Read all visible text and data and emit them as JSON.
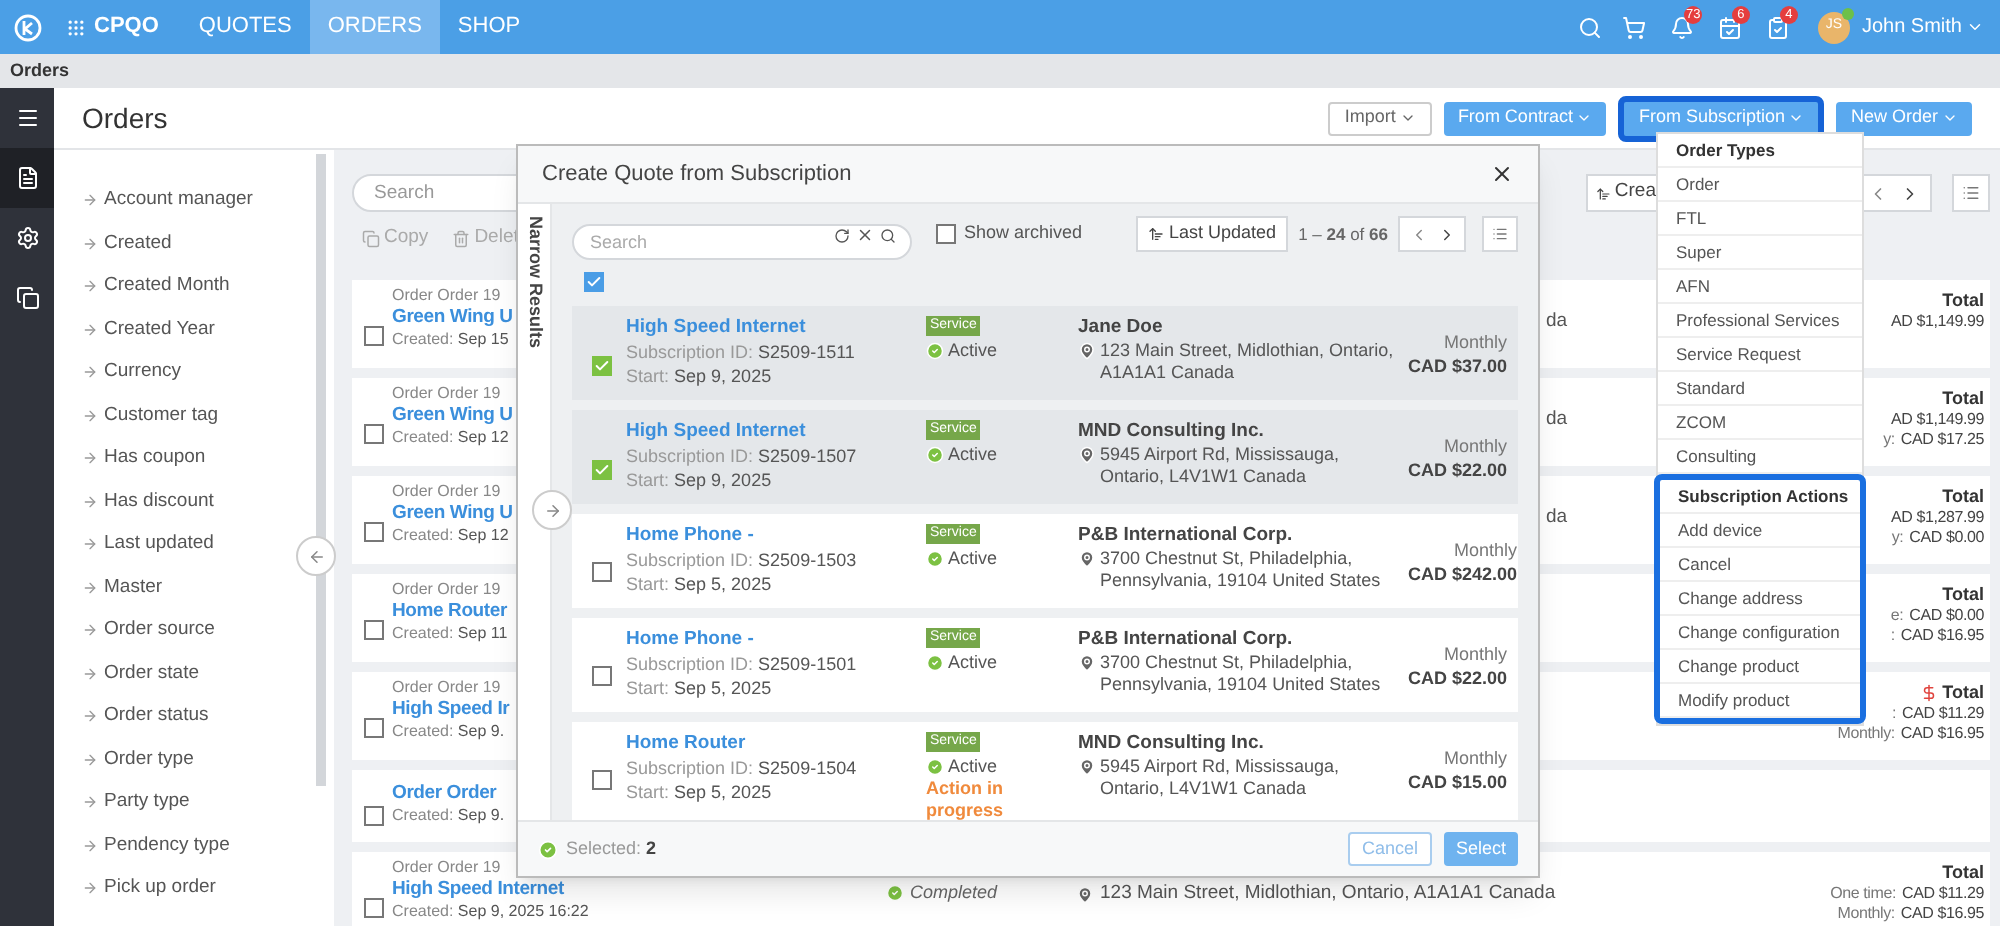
{
  "top_bar": {
    "brand": "CPQO",
    "nav": [
      {
        "label": "QUOTES",
        "selected": false
      },
      {
        "label": "ORDERS",
        "selected": true
      },
      {
        "label": "SHOP",
        "selected": false
      }
    ],
    "alerts": [
      {
        "kind": "bell",
        "count": "73"
      },
      {
        "kind": "calendar",
        "count": "6"
      },
      {
        "kind": "tasks",
        "count": "4"
      }
    ],
    "user": {
      "initials": "JS",
      "name": "John Smith"
    }
  },
  "breadcrumb": "Orders",
  "side_nav": [
    {
      "kind": "menu",
      "selected": false
    },
    {
      "kind": "document",
      "selected": true
    },
    {
      "kind": "settings",
      "selected": false
    },
    {
      "kind": "copy",
      "selected": false
    }
  ],
  "page": {
    "title": "Orders",
    "buttons": [
      {
        "label": "Import",
        "kind": "outline",
        "highlighted": false
      },
      {
        "label": "From Contract",
        "kind": "primary",
        "highlighted": false
      },
      {
        "label": "From Subscription",
        "kind": "primary",
        "highlighted": true
      },
      {
        "label": "New Order",
        "kind": "primary",
        "highlighted": false
      }
    ]
  },
  "filters": [
    "Account manager",
    "Created",
    "Created Month",
    "Created Year",
    "Currency",
    "Customer tag",
    "Has coupon",
    "Has discount",
    "Last updated",
    "Master",
    "Order source",
    "Order state",
    "Order status",
    "Order type",
    "Party type",
    "Pendency type",
    "Pick up order"
  ],
  "orders_list": {
    "search_placeholder": "Search",
    "actions": [
      {
        "kind": "copy",
        "label": "Copy"
      },
      {
        "kind": "delete",
        "label": "Delet"
      }
    ],
    "sort_label": "Crea",
    "orders": [
      {
        "checked": false,
        "subtitle": "Order Order 19",
        "title": "Green Wing U",
        "created_label": "Created:",
        "created": "Sep 15",
        "address_end": "da",
        "total_label": "Total",
        "total_alert": false,
        "lines": [
          {
            "value": "AD $1,149.99"
          }
        ]
      },
      {
        "checked": false,
        "subtitle": "Order Order 19",
        "title": "Green Wing U",
        "created_label": "Created:",
        "created": "Sep 12",
        "address_end": "da",
        "total_label": "Total",
        "total_alert": false,
        "lines": [
          {
            "value": "AD $1,149.99"
          },
          {
            "label": "y:",
            "value": "CAD $17.25"
          }
        ]
      },
      {
        "checked": false,
        "subtitle": "Order Order 19",
        "title": "Green Wing U",
        "created_label": "Created:",
        "created": "Sep 12",
        "address_end": "da",
        "total_label": "Total",
        "total_alert": false,
        "lines": [
          {
            "value": "AD $1,287.99"
          },
          {
            "label": "y:",
            "value": "CAD $0.00"
          }
        ]
      },
      {
        "checked": false,
        "subtitle": "Order Order 19",
        "title": "Home Router",
        "created_label": "Created:",
        "created": "Sep 11",
        "total_label": "Total",
        "total_alert": false,
        "lines": [
          {
            "label": "e:",
            "value": "CAD $0.00"
          },
          {
            "label": ":",
            "value": "CAD $16.95"
          }
        ]
      },
      {
        "checked": false,
        "subtitle": "Order Order 19",
        "title": "High Speed Ir",
        "created_label": "Created:",
        "created": "Sep 9.",
        "total_label": "Total",
        "total_alert": true,
        "lines": [
          {
            "label": ":",
            "value": "CAD $11.29"
          },
          {
            "label": "Monthly:",
            "value": "CAD $16.95"
          }
        ]
      },
      {
        "checked": false,
        "title": "Order Order",
        "created_label": "Created:",
        "created": "Sep 9."
      },
      {
        "checked": false,
        "subtitle": "Order Order 19",
        "title": "High Speed Internet",
        "created_label": "Created:",
        "created": "Sep 9, 2025 16:22",
        "status": "Completed",
        "address": "123 Main Street, Midlothian, Ontario, A1A1A1 Canada",
        "total_label": "Total",
        "total_alert": false,
        "lines": [
          {
            "label": "One time:",
            "value": "CAD $11.29"
          },
          {
            "label": "Monthly:",
            "value": "CAD $16.95"
          }
        ]
      }
    ]
  },
  "modal": {
    "title": "Create Quote from Subscription",
    "side_label": "Narrow Results",
    "search_placeholder": "Search",
    "show_archived": {
      "label": "Show archived",
      "checked": false
    },
    "sort_label": "Last Updated",
    "range": "1 – **24** of **66**",
    "select_all_checked": true,
    "rows": [
      {
        "title": "High Speed Internet",
        "id_label": "Subscription ID:",
        "id": "S2509-1511",
        "start_label": "Start:",
        "start": "Sep 9, 2025",
        "badge": "Service",
        "status": "Active",
        "customer": "Jane Doe",
        "address": "123 Main Street, Midlothian, Ontario, A1A1A1 Canada",
        "period": "Monthly",
        "price": "CAD $37.00",
        "selected": true
      },
      {
        "title": "High Speed Internet",
        "id_label": "Subscription ID:",
        "id": "S2509-1507",
        "start_label": "Start:",
        "start": "Sep 9, 2025",
        "badge": "Service",
        "status": "Active",
        "customer": "MND Consulting Inc.",
        "address": "5945 Airport Rd, Mississauga, Ontario, L4V1W1 Canada",
        "period": "Monthly",
        "price": "CAD $22.00",
        "selected": true
      },
      {
        "title": "Home Phone -",
        "id_label": "Subscription ID:",
        "id": "S2509-1503",
        "start_label": "Start:",
        "start": "Sep 5, 2025",
        "badge": "Service",
        "status": "Active",
        "customer": "P&B International Corp.",
        "address": "3700 Chestnut St, Philadelphia, Pennsylvania, 19104 United States",
        "period": "Monthly",
        "price": "CAD $242.00",
        "selected": false
      },
      {
        "title": "Home Phone -",
        "id_label": "Subscription ID:",
        "id": "S2509-1501",
        "start_label": "Start:",
        "start": "Sep 5, 2025",
        "badge": "Service",
        "status": "Active",
        "customer": "P&B International Corp.",
        "address": "3700 Chestnut St, Philadelphia, Pennsylvania, 19104 United States",
        "period": "Monthly",
        "price": "CAD $22.00",
        "selected": false
      },
      {
        "title": "Home Router",
        "id_label": "Subscription ID:",
        "id": "S2509-1504",
        "start_label": "Start:",
        "start": "Sep 5, 2025",
        "badge": "Service",
        "status": "Active",
        "action": "Action in progress",
        "customer": "MND Consulting Inc.",
        "address": "5945 Airport Rd, Mississauga, Ontario, L4V1W1 Canada",
        "period": "Monthly",
        "price": "CAD $15.00",
        "selected": false
      }
    ],
    "footer": {
      "selected_label": "Selected:",
      "selected_count": "2",
      "cancel": "Cancel",
      "select": "Select"
    }
  },
  "dropdown": {
    "sections": [
      {
        "heading": "Order Types",
        "highlighted": false,
        "items": [
          "Order",
          "FTL",
          "Super",
          "AFN",
          "Professional Services",
          "Service Request",
          "Standard",
          "ZCOM",
          "Consulting"
        ]
      },
      {
        "heading": "Subscription Actions",
        "highlighted": true,
        "items": [
          "Add device",
          "Cancel",
          "Change address",
          "Change configuration",
          "Change product",
          "Modify product"
        ]
      }
    ]
  }
}
